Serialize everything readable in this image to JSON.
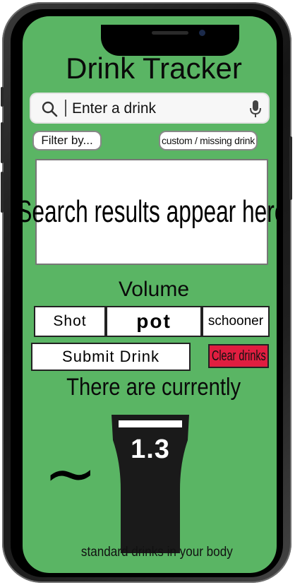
{
  "app": {
    "title": "Drink Tracker"
  },
  "search": {
    "placeholder": "Enter a drink",
    "value": ""
  },
  "actions": {
    "filter_label": "Filter by...",
    "custom_label": "custom / missing drink"
  },
  "results": {
    "placeholder_text": "Search results appear here"
  },
  "volume": {
    "label": "Volume",
    "options": [
      "Shot",
      "pot",
      "schooner"
    ]
  },
  "buttons": {
    "submit_label": "Submit Drink",
    "clear_label": "Clear drinks"
  },
  "status": {
    "prefix": "There are currently",
    "approx_symbol": "~",
    "standard_drinks": "1.3",
    "suffix": "standard drinks in your body"
  },
  "colors": {
    "screen_background": "#5ab564",
    "clear_button": "#e01e40",
    "glass": "#1a1a1a"
  },
  "icons": {
    "search": "search-icon",
    "microphone": "microphone-icon",
    "glass": "pint-glass-icon"
  }
}
